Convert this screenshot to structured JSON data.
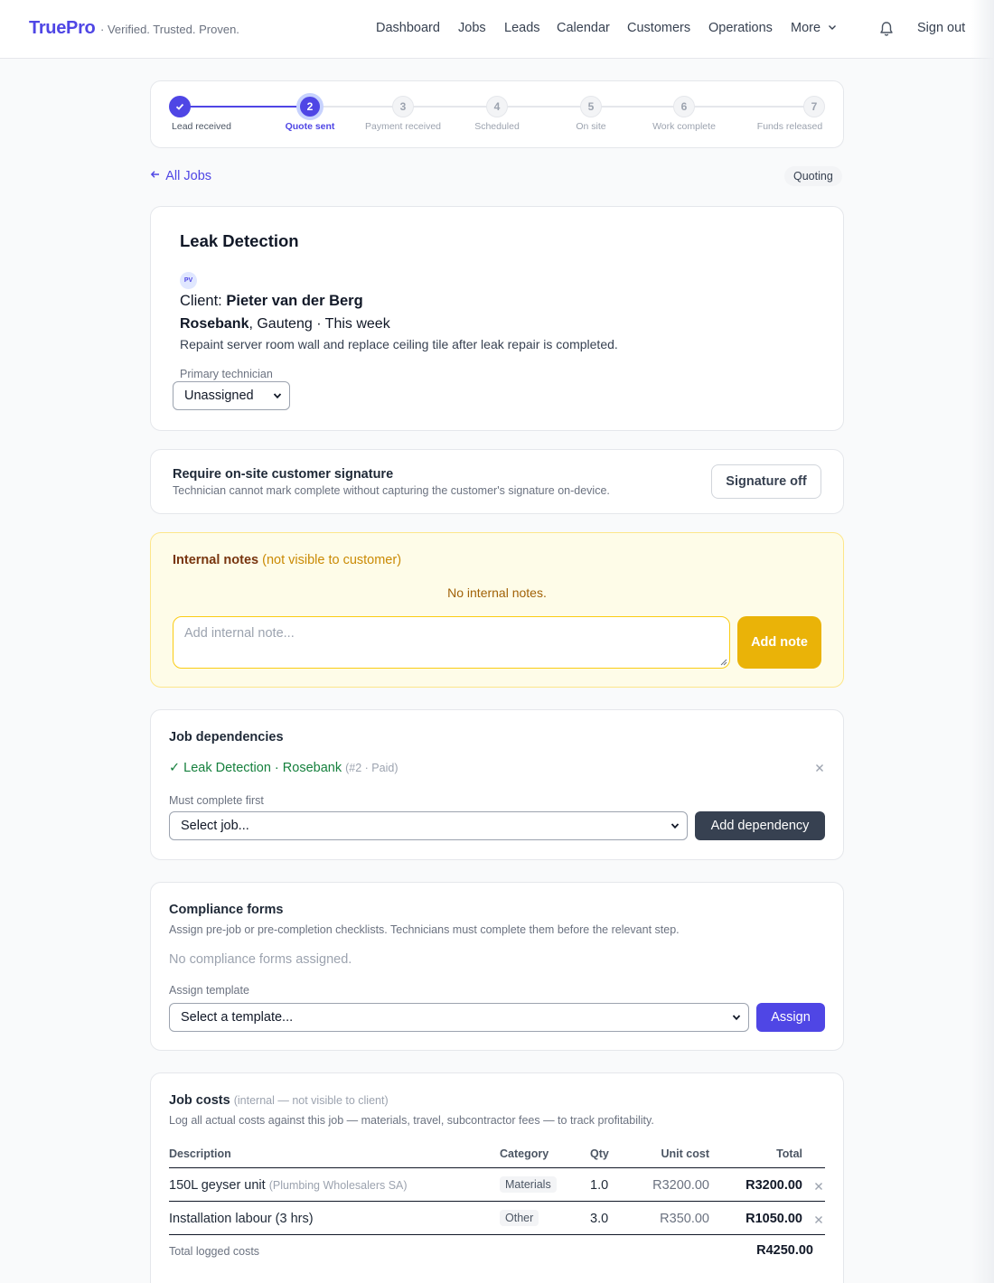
{
  "header": {
    "brand": "TruePro",
    "tagline": "· Verified. Trusted. Proven.",
    "nav": [
      "Dashboard",
      "Jobs",
      "Leads",
      "Calendar",
      "Customers",
      "Operations",
      "More"
    ],
    "sign_out": "Sign out",
    "icons": {
      "bell": "bell-icon",
      "more": "chevron-down-icon"
    }
  },
  "stepper": {
    "current_step": 2,
    "steps": [
      {
        "number": "1",
        "label": "Lead received",
        "state": "done"
      },
      {
        "number": "2",
        "label": "Quote sent",
        "state": "active"
      },
      {
        "number": "3",
        "label": "Payment received",
        "state": "pending"
      },
      {
        "number": "4",
        "label": "Scheduled",
        "state": "pending"
      },
      {
        "number": "5",
        "label": "On site",
        "state": "pending"
      },
      {
        "number": "6",
        "label": "Work complete",
        "state": "pending"
      },
      {
        "number": "7",
        "label": "Funds released",
        "state": "pending"
      }
    ]
  },
  "back_link": "All Jobs",
  "status": "Quoting",
  "job": {
    "title": "Leak Detection",
    "client_initials": "PV",
    "client_prefix": "Client: ",
    "client_name": "Pieter van der Berg",
    "suburb": "Rosebank",
    "location_rest": ", Gauteng · This week",
    "description": "Repaint server room wall and replace ceiling tile after leak repair is completed.",
    "technician_label": "Primary technician",
    "technician_value": "Unassigned"
  },
  "signature": {
    "title": "Require on-site customer signature",
    "subtitle": "Technician cannot mark complete without capturing the customer's signature on-device.",
    "button": "Signature off"
  },
  "notes": {
    "title": "Internal notes",
    "title_note": "(not visible to customer)",
    "empty": "No internal notes.",
    "placeholder": "Add internal note...",
    "button": "Add note"
  },
  "dependencies": {
    "title": "Job dependencies",
    "item_label": "✓ Leak Detection · Rosebank",
    "item_meta": "(#2 · Paid)",
    "must_complete_label": "Must complete first",
    "select_value": "Select job...",
    "button": "Add dependency"
  },
  "compliance": {
    "title": "Compliance forms",
    "subtitle": "Assign pre-job or pre-completion checklists. Technicians must complete them before the relevant step.",
    "empty": "No compliance forms assigned.",
    "assign_label": "Assign template",
    "select_value": "Select a template...",
    "button": "Assign"
  },
  "costs": {
    "title": "Job costs",
    "title_note": "(internal — not visible to client)",
    "subtitle": "Log all actual costs against this job — materials, travel, subcontractor fees — to track profitability.",
    "columns": [
      "Description",
      "Category",
      "Qty",
      "Unit cost",
      "Total"
    ],
    "rows": [
      {
        "description": "150L geyser unit",
        "supplier": "(Plumbing Wholesalers SA)",
        "category": "Materials",
        "qty": "1.0",
        "unit_cost": "R3200.00",
        "total": "R3200.00"
      },
      {
        "description": "Installation labour (3 hrs)",
        "supplier": "",
        "category": "Other",
        "qty": "3.0",
        "unit_cost": "R350.00",
        "total": "R1050.00"
      }
    ],
    "total_label": "Total logged costs",
    "total_value": "R4250.00"
  }
}
